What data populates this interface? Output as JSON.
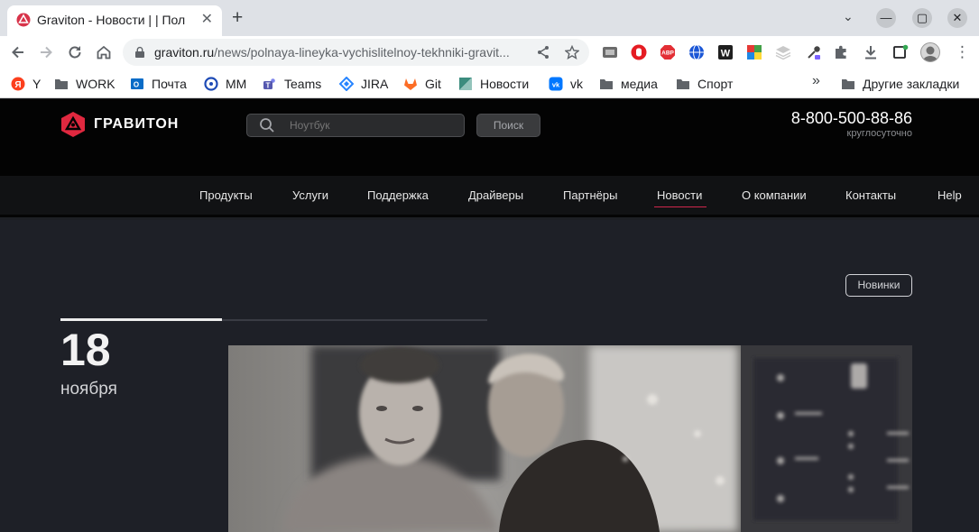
{
  "browser": {
    "tab": {
      "title": "Graviton - Новости | | Пол",
      "close_icon": "close-icon"
    },
    "window_controls": {
      "minimize": "—",
      "maximize": "▢",
      "close": "✕"
    },
    "address": {
      "host": "graviton.ru",
      "path": "/news/polnaya-lineyka-vychislitelnoy-tekhniki-gravit..."
    },
    "bookmarks": [
      {
        "label": "Y",
        "icon": "yandex-icon",
        "color": "#fc3f1d"
      },
      {
        "label": "WORK",
        "icon": "folder-icon",
        "color": "#5f6368"
      },
      {
        "label": "Почта",
        "icon": "outlook-icon",
        "color": "#0a6cc7"
      },
      {
        "label": "MM",
        "icon": "mattermost-icon",
        "color": "#1e4bb6"
      },
      {
        "label": "Teams",
        "icon": "teams-icon",
        "color": "#5558af"
      },
      {
        "label": "JIRA",
        "icon": "jira-icon",
        "color": "#2684ff"
      },
      {
        "label": "Git",
        "icon": "gitlab-icon",
        "color": "#fc6d26"
      },
      {
        "label": "Новости",
        "icon": "news-icon",
        "color": "#3c8c7e"
      },
      {
        "label": "vk",
        "icon": "vk-icon",
        "color": "#0077ff"
      },
      {
        "label": "медиа",
        "icon": "folder-icon",
        "color": "#5f6368"
      },
      {
        "label": "Спорт",
        "icon": "folder-icon",
        "color": "#5f6368"
      }
    ],
    "bookmarks_more": "»",
    "other_bookmarks": "Другие закладки"
  },
  "site": {
    "logo_text": "ГРАВИТОН",
    "brand_color": "#e0283f",
    "search": {
      "placeholder": "Ноутбук",
      "button": "Поиск"
    },
    "phone": "8-800-500-88-86",
    "phone_note": "круглосуточно",
    "nav": [
      "Продукты",
      "Услуги",
      "Поддержка",
      "Драйверы",
      "Партнёры",
      "Новости",
      "О компании",
      "Контакты",
      "Help"
    ],
    "nav_active": "Новости",
    "news": {
      "badge": "Новинки",
      "day": "18",
      "month": "ноября"
    }
  }
}
